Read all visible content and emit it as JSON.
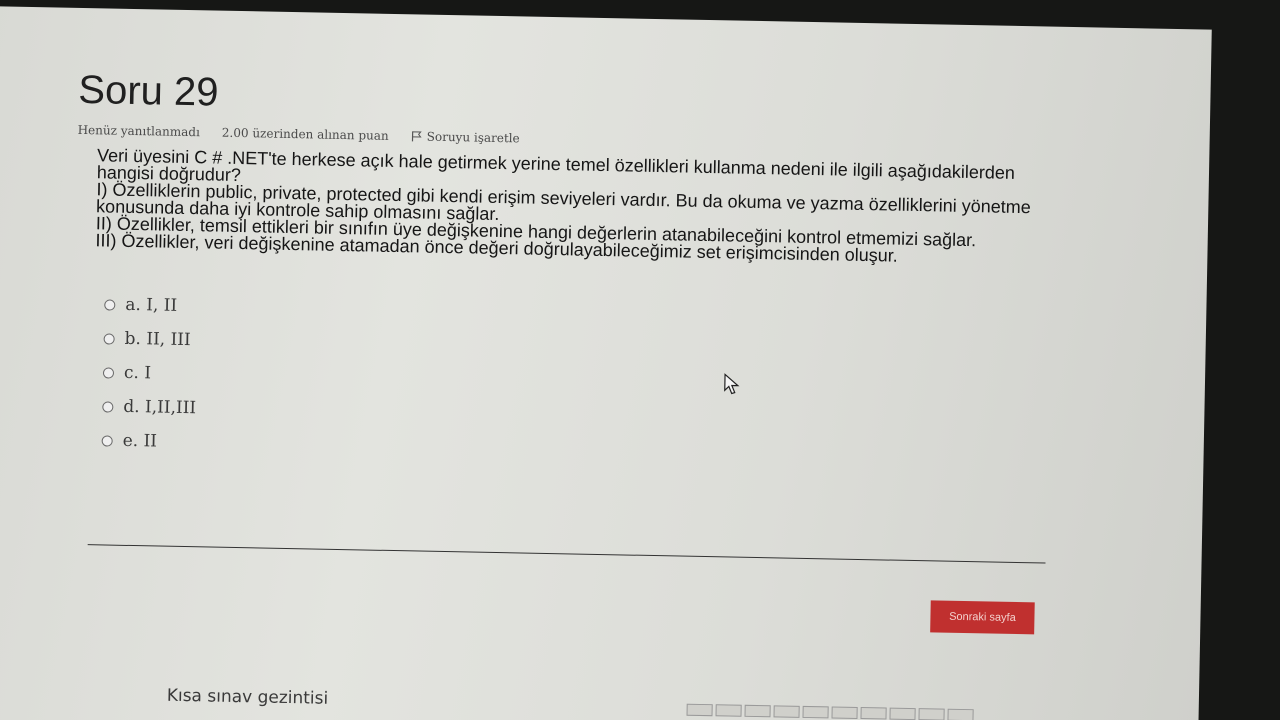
{
  "question": {
    "title": "Soru 29",
    "status": "Henüz yanıtlanmadı",
    "points": "2.00 üzerinden alınan puan",
    "flag_label": "Soruyu işaretle",
    "text_lines": [
      "Veri üyesini C # .NET'te herkese açık hale getirmek yerine temel özellikleri kullanma nedeni ile ilgili aşağıdakilerden",
      "hangisi doğrudur?",
      "I) Özelliklerin public, private, protected gibi kendi erişim seviyeleri vardır. Bu da okuma ve yazma özelliklerini yönetme",
      "konusunda daha iyi kontrole sahip olmasını sağlar.",
      "II) Özellikler, temsil ettikleri bir sınıfın üye değişkenine hangi değerlerin atanabileceğini kontrol etmemizi sağlar.",
      "III) Özellikler, veri değişkenine atamadan önce değeri doğrulayabileceğimiz set erişimcisinden oluşur."
    ]
  },
  "options": [
    {
      "label": "a. I, II"
    },
    {
      "label": "b. II, III"
    },
    {
      "label": "c. I"
    },
    {
      "label": "d. I,II,III"
    },
    {
      "label": "e. II"
    }
  ],
  "footer": {
    "next_label": "Sonraki sayfa",
    "nav_title": "Kısa sınav gezintisi"
  },
  "icons": {
    "flag": "flag-icon",
    "cursor": "mouse-pointer-icon"
  }
}
